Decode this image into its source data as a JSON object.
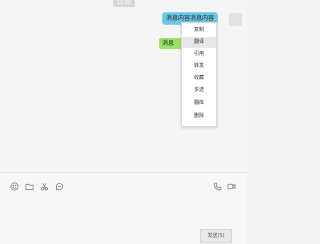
{
  "timestamp": "11:00",
  "messages": [
    {
      "text": "消息内容消息内容"
    },
    {
      "text": "消息"
    }
  ],
  "context_menu": {
    "items": [
      {
        "label": "复制",
        "highlighted": false
      },
      {
        "label": "翻译",
        "highlighted": true
      },
      {
        "label": "引用",
        "highlighted": false
      },
      {
        "label": "转发",
        "highlighted": false
      },
      {
        "label": "收藏",
        "highlighted": false
      },
      {
        "label": "多选",
        "highlighted": false
      },
      {
        "label": "翻库",
        "highlighted": false
      },
      {
        "label": "删除",
        "highlighted": false
      }
    ]
  },
  "toolbar": {
    "left_icons": [
      "emoji-icon",
      "folder-icon",
      "scissors-icon",
      "chat-history-icon"
    ],
    "right_icons": [
      "phone-icon",
      "video-icon"
    ]
  },
  "send_label": "发送(S)",
  "colors": {
    "selected_bubble": "#6bc7e6",
    "bubble": "#98e165"
  }
}
